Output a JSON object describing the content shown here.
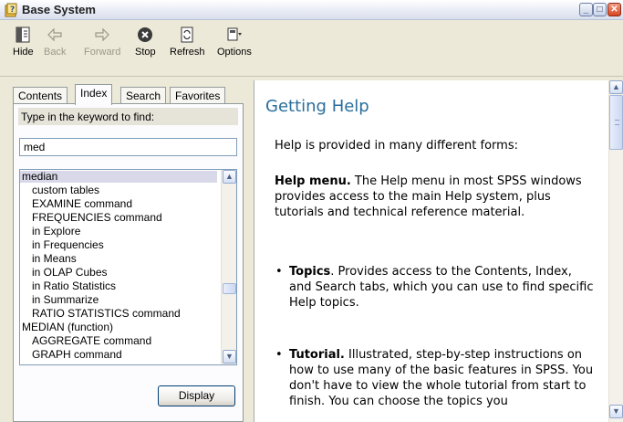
{
  "window": {
    "title": "Base System"
  },
  "toolbar": {
    "hide": "Hide",
    "back": "Back",
    "forward": "Forward",
    "stop": "Stop",
    "refresh": "Refresh",
    "options": "Options"
  },
  "tabs": [
    {
      "label": "Contents"
    },
    {
      "label": "Index"
    },
    {
      "label": "Search"
    },
    {
      "label": "Favorites"
    }
  ],
  "index": {
    "prompt": "Type in the keyword to find:",
    "search_value": "med",
    "items": [
      {
        "text": "median",
        "indent": 0
      },
      {
        "text": "custom tables",
        "indent": 1
      },
      {
        "text": "EXAMINE command",
        "indent": 1
      },
      {
        "text": "FREQUENCIES command",
        "indent": 1
      },
      {
        "text": "in Explore",
        "indent": 1
      },
      {
        "text": "in Frequencies",
        "indent": 1
      },
      {
        "text": "in Means",
        "indent": 1
      },
      {
        "text": "in OLAP Cubes",
        "indent": 1
      },
      {
        "text": "in Ratio Statistics",
        "indent": 1
      },
      {
        "text": "in Summarize",
        "indent": 1
      },
      {
        "text": "RATIO STATISTICS command",
        "indent": 1
      },
      {
        "text": "MEDIAN (function)",
        "indent": 0
      },
      {
        "text": "AGGREGATE command",
        "indent": 1
      },
      {
        "text": "GRAPH command",
        "indent": 1
      }
    ],
    "selected_index": 0,
    "display_button": "Display"
  },
  "content": {
    "title": "Getting Help",
    "intro": "Help is provided in many different forms:",
    "help_menu_label": "Help menu.",
    "help_menu_text": " The Help menu in most SPSS windows provides access to the main Help system, plus tutorials and technical reference material.",
    "bullets": [
      {
        "label": "Topics",
        "text": ". Provides access to the Contents, Index, and Search tabs, which you can use to find specific Help topics."
      },
      {
        "label": "Tutorial.",
        "text": " Illustrated, step-by-step instructions on how to use many of the basic features in SPSS. You don't have to view the whole tutorial from start to finish. You can choose the topics you"
      }
    ]
  },
  "icons": {
    "app": "help-book-icon",
    "hide": "hide-pane-icon",
    "back": "back-arrow-icon",
    "forward": "forward-arrow-icon",
    "stop": "stop-icon",
    "refresh": "refresh-icon",
    "options": "options-icon"
  },
  "colors": {
    "heading": "#2A6E9C",
    "list_selection": "#D8D8E8",
    "face": "#ECE9D8"
  }
}
